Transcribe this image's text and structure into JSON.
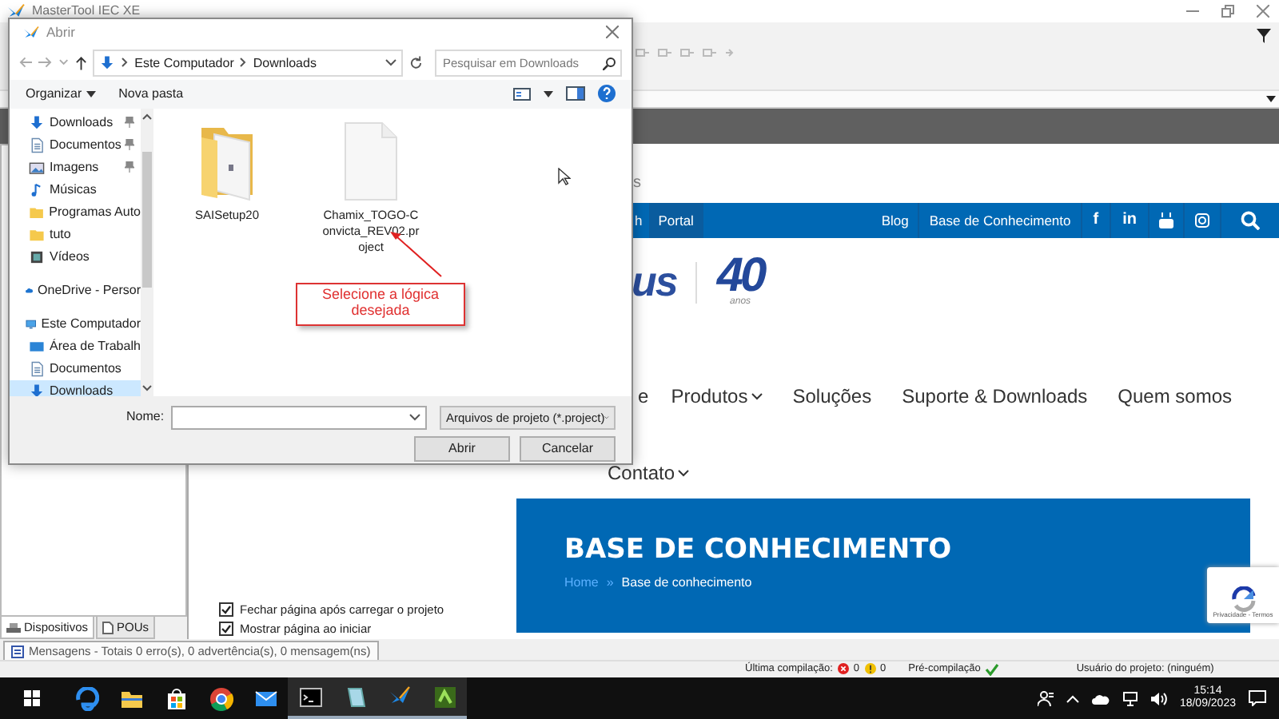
{
  "app": {
    "title": "MasterTool IEC XE"
  },
  "dialog": {
    "title": "Abrir",
    "path": [
      "Este Computador",
      "Downloads"
    ],
    "search": {
      "placeholder": "Pesquisar em Downloads"
    },
    "commands": [
      {
        "label": "Organizar",
        "menu": true
      },
      {
        "label": "Nova pasta",
        "menu": false
      }
    ],
    "nav_pane": [
      {
        "items": [
          {
            "label": "Downloads",
            "kind": "download",
            "pinned": true,
            "selected": false
          },
          {
            "label": "Documentos",
            "kind": "document",
            "pinned": true,
            "selected": false
          },
          {
            "label": "Imagens",
            "kind": "image",
            "pinned": true,
            "selected": false
          },
          {
            "label": "Músicas",
            "kind": "music",
            "pinned": false,
            "selected": false
          },
          {
            "label": "Programas Auto",
            "kind": "folder",
            "pinned": false,
            "selected": false
          },
          {
            "label": "tuto",
            "kind": "folder",
            "pinned": false,
            "selected": false
          },
          {
            "label": "Vídeos",
            "kind": "video",
            "pinned": false,
            "selected": false
          }
        ]
      },
      {
        "items": [
          {
            "label": "OneDrive - Persor",
            "kind": "cloud",
            "pinned": false,
            "selected": false
          }
        ]
      },
      {
        "items": [
          {
            "label": "Este Computador",
            "kind": "computer",
            "pinned": false,
            "selected": false,
            "children": [
              {
                "label": "Área de Trabalh",
                "kind": "desktop",
                "pinned": false,
                "selected": false
              },
              {
                "label": "Documentos",
                "kind": "document",
                "pinned": false,
                "selected": false
              },
              {
                "label": "Downloads",
                "kind": "download",
                "pinned": false,
                "selected": true
              }
            ]
          }
        ]
      }
    ],
    "files": [
      {
        "name": "SAISetup20",
        "kind": "folder"
      },
      {
        "name": "Chamix_TOGO-Convicta_REV02.project",
        "kind": "file"
      }
    ],
    "annotation": "Selecione a lógica desejada",
    "name_label": "Nome:",
    "filetype": "Arquivos de projeto (*.project)",
    "buttons": [
      "Abrir",
      "Cancelar"
    ]
  },
  "web": {
    "top_fragment": "s",
    "nav": {
      "left": [
        {
          "label": "h",
          "selected": false
        },
        {
          "label": "Portal",
          "selected": true
        }
      ],
      "right": [
        "Blog",
        "Base de Conhecimento"
      ],
      "social": [
        {
          "kind": "text",
          "label": "f"
        },
        {
          "kind": "text",
          "label": "in"
        },
        {
          "kind": "tube"
        },
        {
          "kind": "camera"
        },
        {
          "kind": "search"
        }
      ]
    },
    "logo": {
      "fragment": "us",
      "badge": "40",
      "caption": "anos"
    },
    "menu": [
      {
        "label": "e",
        "caret": false
      },
      {
        "label": "Produtos",
        "caret": true
      },
      {
        "label": "Soluções",
        "caret": false
      },
      {
        "label": "Suporte & Downloads",
        "caret": false
      },
      {
        "label": "Quem somos",
        "caret": false
      },
      {
        "label": "Contato",
        "caret": true
      }
    ],
    "banner": {
      "title": "BASE DE CONHECIMENTO",
      "breadcrumb": [
        {
          "label": "Home",
          "link": true
        },
        {
          "label": "Base de conhecimento",
          "link": false
        }
      ],
      "separator": "»"
    },
    "recaptcha": {
      "caption": "Privacidade - Termos"
    }
  },
  "options": [
    {
      "label": "Fechar página após carregar o projeto",
      "checked": true
    },
    {
      "label": "Mostrar página ao iniciar",
      "checked": true
    }
  ],
  "left_tabs": [
    {
      "label": "Dispositivos",
      "selected": true
    },
    {
      "label": "POUs",
      "selected": false
    }
  ],
  "messages_tab": "Mensagens - Totais 0 erro(s), 0 advertência(s), 0 mensagem(ns)",
  "status": {
    "last_build_label": "Última compilação:",
    "errors": "0",
    "warnings": "0",
    "precompile": "Pré-compilação",
    "precompile_ok": true,
    "user": "Usuário do projeto: (ninguém)"
  },
  "taskbar": {
    "apps": [
      {
        "kind": "edge",
        "running": false
      },
      {
        "kind": "explorer",
        "running": false
      },
      {
        "kind": "store",
        "running": false
      },
      {
        "kind": "chrome",
        "running": false
      },
      {
        "kind": "mail",
        "running": false
      },
      {
        "kind": "terminal",
        "running": true
      },
      {
        "kind": "notepad",
        "running": true
      },
      {
        "kind": "bird",
        "running": true
      },
      {
        "kind": "green",
        "running": true
      }
    ],
    "time": "15:14",
    "date": "18/09/2023"
  }
}
